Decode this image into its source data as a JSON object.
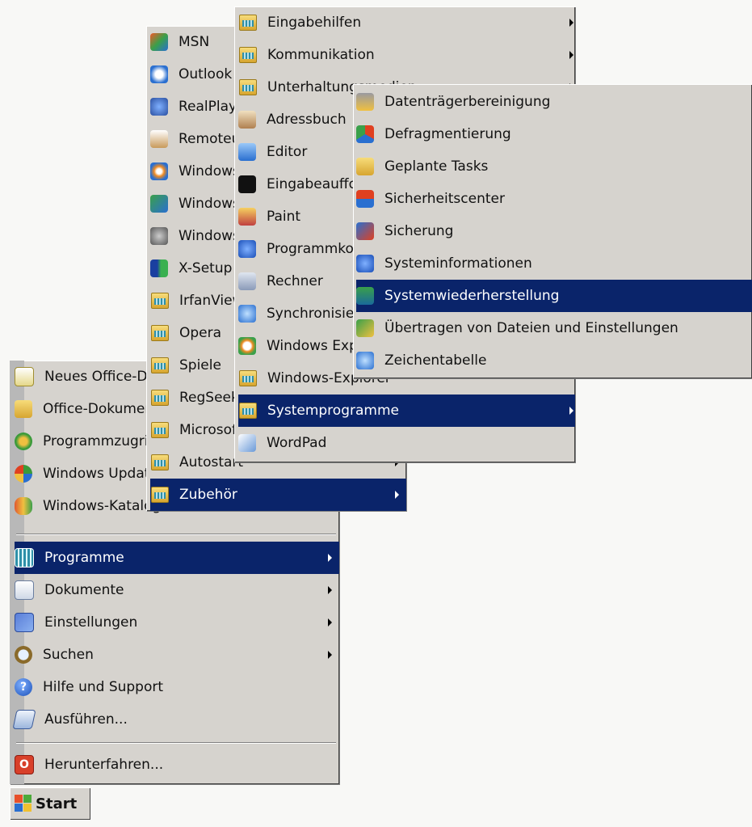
{
  "start_menu": {
    "top_items": [
      {
        "label": "Neues Office-Dokument",
        "icon": "office-new-icon"
      },
      {
        "label": "Office-Dokument öffnen",
        "icon": "office-open-icon"
      },
      {
        "label": "Programmzugriff und -standards",
        "icon": "program-access-icon"
      },
      {
        "label": "Windows Update",
        "icon": "windows-update-icon"
      },
      {
        "label": "Windows-Katalog",
        "icon": "windows-catalog-icon"
      }
    ],
    "main_items": [
      {
        "label": "Programme",
        "arrow": true
      },
      {
        "label": "Dokumente",
        "arrow": true
      },
      {
        "label": "Einstellungen",
        "arrow": true
      },
      {
        "label": "Suchen",
        "arrow": true
      },
      {
        "label": "Hilfe und Support",
        "arrow": false
      },
      {
        "label": "Ausführen...",
        "arrow": false
      }
    ],
    "shutdown_label": "Herunterfahren...",
    "start_button_label": "Start"
  },
  "programs_menu": {
    "items": [
      {
        "label": "MSN"
      },
      {
        "label": "Outlook Express"
      },
      {
        "label": "RealPlayer"
      },
      {
        "label": "Remoteunterstützung"
      },
      {
        "label": "Windows Media Player"
      },
      {
        "label": "Windows Messenger"
      },
      {
        "label": "Windows Movie Maker"
      },
      {
        "label": "X-Setup"
      },
      {
        "label": "IrfanView"
      },
      {
        "label": "Opera"
      },
      {
        "label": "Spiele"
      },
      {
        "label": "RegSeeker"
      },
      {
        "label": "Microsoft Office"
      },
      {
        "label": "Autostart"
      },
      {
        "label": "Zubehör"
      }
    ]
  },
  "accessories_menu": {
    "items": [
      {
        "label": "Eingabehilfen"
      },
      {
        "label": "Kommunikation"
      },
      {
        "label": "Unterhaltungsmedien"
      },
      {
        "label": "Adressbuch"
      },
      {
        "label": "Editor"
      },
      {
        "label": "Eingabeaufforderung"
      },
      {
        "label": "Paint"
      },
      {
        "label": "Programmkompatibilitäts-Assistent"
      },
      {
        "label": "Rechner"
      },
      {
        "label": "Synchronisieren"
      },
      {
        "label": "Windows Explorer"
      },
      {
        "label": "Windows-Explorer"
      },
      {
        "label": "Systemprogramme"
      },
      {
        "label": "WordPad"
      }
    ]
  },
  "system_tools_menu": {
    "items": [
      {
        "label": "Datenträgerbereinigung"
      },
      {
        "label": "Defragmentierung"
      },
      {
        "label": "Geplante Tasks"
      },
      {
        "label": "Sicherheitscenter"
      },
      {
        "label": "Sicherung"
      },
      {
        "label": "Systeminformationen"
      },
      {
        "label": "Systemwiederherstellung"
      },
      {
        "label": "Übertragen von Dateien und Einstellungen"
      },
      {
        "label": "Zeichentabelle"
      }
    ]
  },
  "colors": {
    "menu_bg": "#d6d3ce",
    "highlight": "#0a246a",
    "highlight_text": "#ffffff"
  }
}
